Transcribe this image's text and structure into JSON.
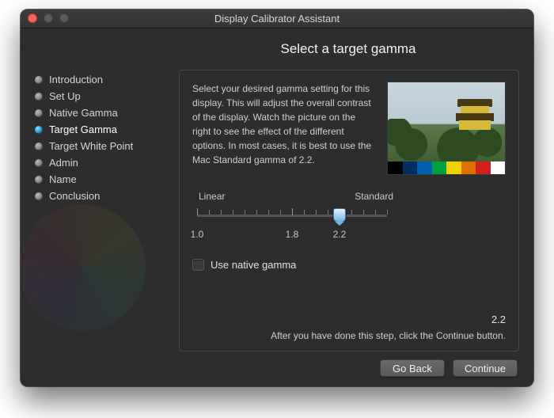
{
  "window": {
    "title": "Display Calibrator Assistant"
  },
  "heading": "Select a target gamma",
  "sidebar": {
    "items": [
      {
        "label": "Introduction",
        "active": false
      },
      {
        "label": "Set Up",
        "active": false
      },
      {
        "label": "Native Gamma",
        "active": false
      },
      {
        "label": "Target Gamma",
        "active": true
      },
      {
        "label": "Target White Point",
        "active": false
      },
      {
        "label": "Admin",
        "active": false
      },
      {
        "label": "Name",
        "active": false
      },
      {
        "label": "Conclusion",
        "active": false
      }
    ]
  },
  "panel": {
    "description": "Select your desired gamma setting for this display. This will adjust the overall contrast of the display. Watch the picture on the right to see the effect of the different options. In most cases, it is best to use the Mac Standard gamma of 2.2.",
    "slider": {
      "left_label": "Linear",
      "right_label": "Standard",
      "ticks": [
        "1.0",
        "1.8",
        "2.2"
      ],
      "min": 1.0,
      "max": 2.6,
      "value": 2.2
    },
    "checkbox_label": "Use native gamma",
    "checkbox_checked": false,
    "value_readout": "2.2",
    "hint": "After you have done this step, click the Continue button."
  },
  "preview": {
    "colorbar": [
      "#000000",
      "#003060",
      "#0060b0",
      "#00a040",
      "#f0d000",
      "#e07000",
      "#d02020",
      "#ffffff"
    ]
  },
  "footer": {
    "back_label": "Go Back",
    "continue_label": "Continue"
  }
}
